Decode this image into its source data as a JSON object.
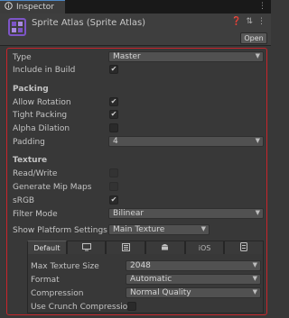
{
  "inspector": {
    "tab_title": "Inspector",
    "menu_icon": "kebab-menu-icon",
    "lock_icon": "lock-icon"
  },
  "header": {
    "title": "Sprite Atlas (Sprite Atlas)",
    "open_label": "Open",
    "icons": [
      "help-icon",
      "presets-icon",
      "context-menu-icon"
    ]
  },
  "fields": {
    "type_label": "Type",
    "type_value": "Master",
    "include_label": "Include in Build",
    "include_checked": true
  },
  "packing": {
    "heading": "Packing",
    "allow_rotation_label": "Allow Rotation",
    "allow_rotation": true,
    "tight_packing_label": "Tight Packing",
    "tight_packing": true,
    "alpha_dilation_label": "Alpha Dilation",
    "alpha_dilation": false,
    "padding_label": "Padding",
    "padding_value": "4"
  },
  "texture": {
    "heading": "Texture",
    "read_write_label": "Read/Write",
    "read_write": false,
    "mipmaps_label": "Generate Mip Maps",
    "mipmaps": false,
    "srgb_label": "sRGB",
    "srgb": true,
    "filter_label": "Filter Mode",
    "filter_value": "Bilinear"
  },
  "platform": {
    "show_label": "Show Platform Settings F",
    "show_value": "Main Texture",
    "tabs": [
      "Default",
      "standalone-icon",
      "webgl-icon",
      "android-icon",
      "iOS",
      "server-icon"
    ],
    "ios_label": "iOS",
    "max_size_label": "Max Texture Size",
    "max_size_value": "2048",
    "format_label": "Format",
    "format_value": "Automatic",
    "compression_label": "Compression",
    "compression_value": "Normal Quality",
    "crunch_label": "Use Crunch Compression",
    "crunch": false
  },
  "colors": {
    "highlight": "#c8242b",
    "asset_icon": "#7d55c7"
  }
}
